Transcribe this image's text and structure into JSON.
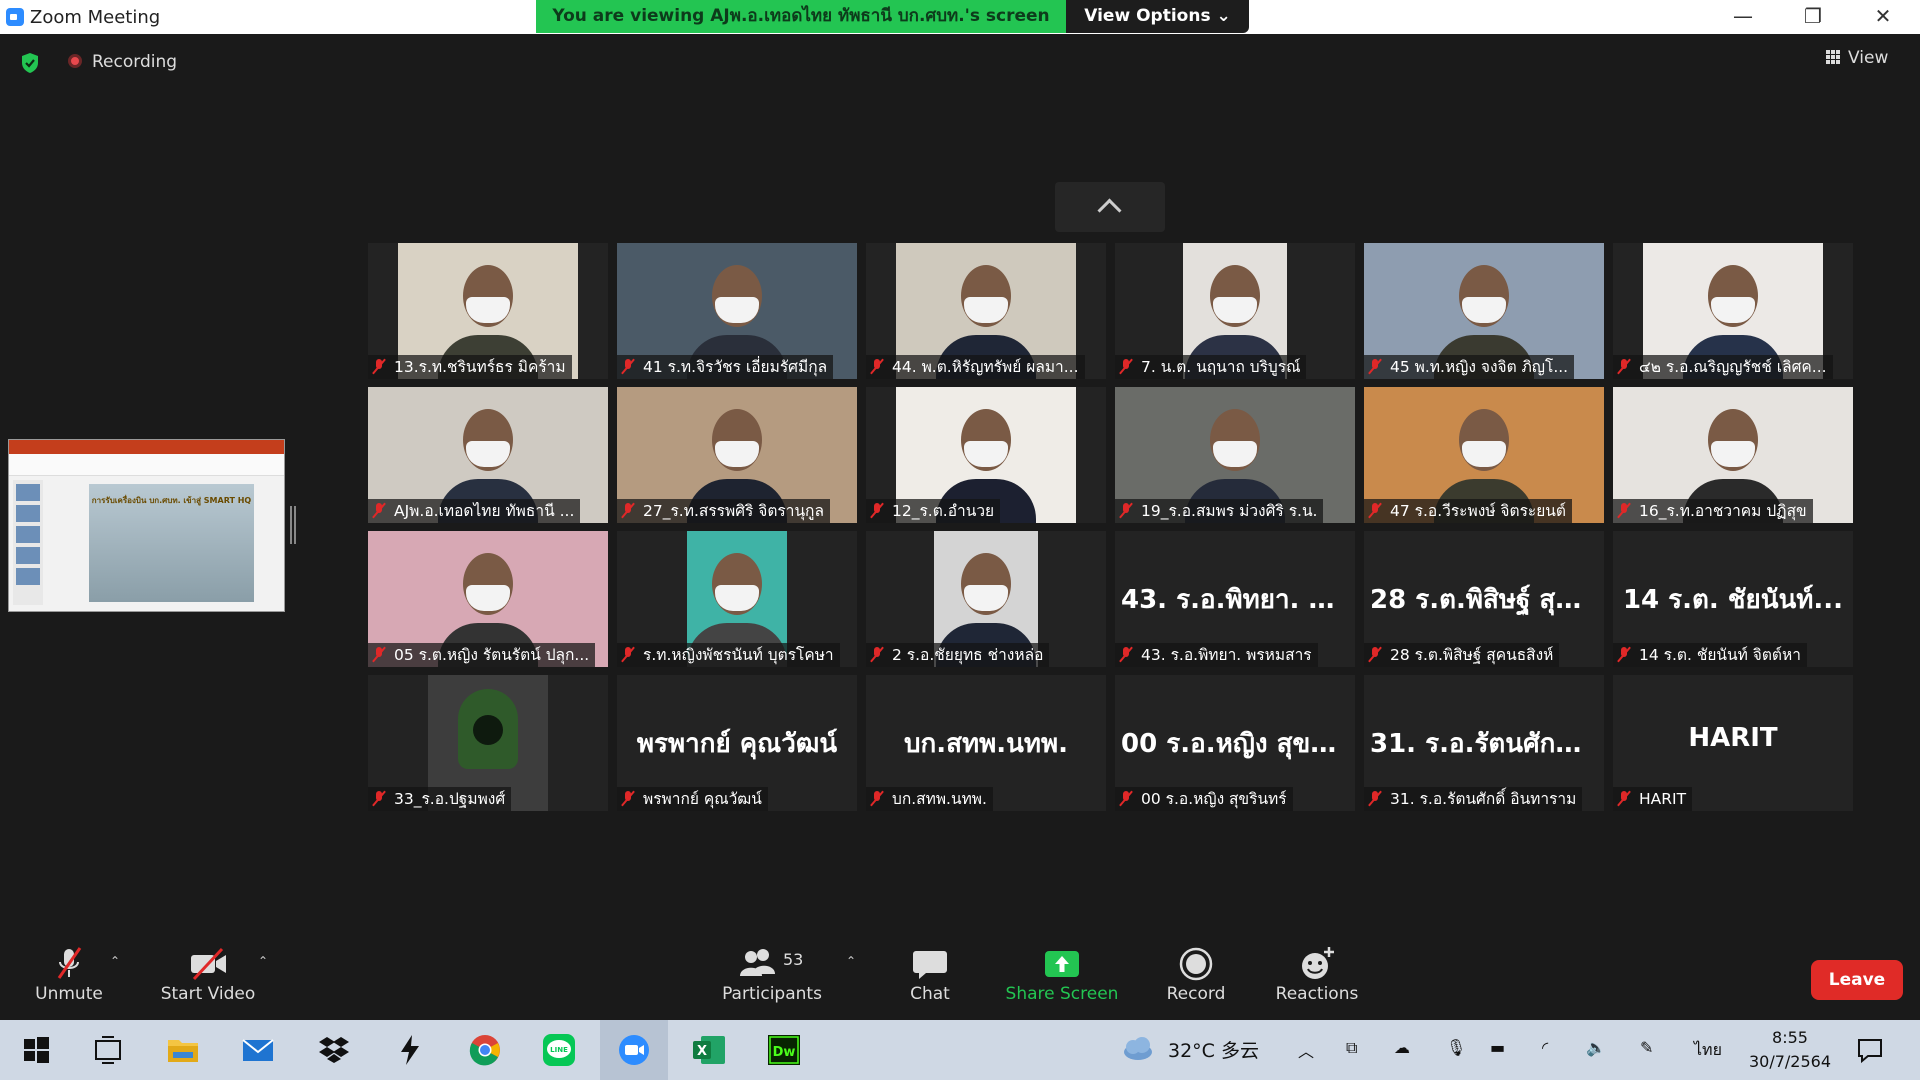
{
  "window": {
    "title": "Zoom Meeting",
    "share_banner": "You are viewing AJพ.อ.เทอดไทย ทัพธานี  บก.ศบท.'s screen",
    "view_options": "View Options ⌄",
    "minimize": "—",
    "restore": "❐",
    "close": "✕"
  },
  "meeting": {
    "recording_label": "Recording",
    "view_label": "View",
    "accent_color": "#23c552"
  },
  "participants": [
    {
      "name": "13.ร.ท.ชรินทร์ธร มิคร้าม",
      "video": true,
      "shirt": "#3d3f34"
    },
    {
      "name": "41 ร.ท.จิรวัชร เอี่ยมรัศมีกุล",
      "video": true,
      "shirt": "#2a2f3a"
    },
    {
      "name": "44. พ.ต.หิรัญทรัพย์ ผลมา...",
      "video": true,
      "shirt": "#1f2636"
    },
    {
      "name": "7. น.ต. นฤนาถ   บริบูรณ์",
      "video": true,
      "shirt": "#2c3245"
    },
    {
      "name": "45 พ.ท.หญิง จงจิต  ภิญโ...",
      "video": true,
      "shirt": "#3a3a30"
    },
    {
      "name": "๔๒ ร.อ.ณริญญรัชช์ เลิศค...",
      "video": true,
      "shirt": "#26324a"
    },
    {
      "name": "AJพ.อ.เทอดไทย ทัพธานี  ...",
      "video": true,
      "shirt": "#283040"
    },
    {
      "name": "27_ร.ท.สรรพศิริ  จิตรานุกูล",
      "video": true,
      "shirt": "#1e2330"
    },
    {
      "name": "12_ร.ต.อำนวย",
      "video": true,
      "shirt": "#1c2030"
    },
    {
      "name": "19_ร.อ.สมพร  ม่วงศิริ ร.น.",
      "video": true,
      "shirt": "#252b3a"
    },
    {
      "name": "47 ร.อ.วีระพงษ์ จิตระยนต์",
      "video": true,
      "shirt": "#3b3b2e"
    },
    {
      "name": "16_ร.ท.อาชวาคม ปฏิสุข",
      "video": true,
      "shirt": "#2a2a2a"
    },
    {
      "name": "05 ร.ต.หญิง รัตนรัตน์ ปลุก...",
      "video": true,
      "shirt": "#333"
    },
    {
      "name": "ร.ท.หญิงพัชรนันท์ บุตรโคษา",
      "video": true,
      "shirt": "#444"
    },
    {
      "name": "2  ร.อ.ชัยยุทธ  ช่างหล่อ",
      "video": true,
      "shirt": "#1f2636"
    },
    {
      "name": "43. ร.อ.พิทยา.  พรหมสาร",
      "video": false,
      "big": "43. ร.อ.พิทยา.  พ..."
    },
    {
      "name": "28 ร.ต.พิสิษฐ์ สุคนธสิงห์",
      "video": false,
      "big": "28 ร.ต.พิสิษฐ์ สุค..."
    },
    {
      "name": "14 ร.ต. ชัยนันท์ จิตต์หา",
      "video": false,
      "big": "14 ร.ต. ชัยนันท์..."
    },
    {
      "name": "33_ร.อ.ปฐมพงศ์",
      "video": true,
      "hood": true
    },
    {
      "name": "พรพากย์ คุณวัฒน์",
      "video": false,
      "big": "พรพากย์ คุณวัฒน์"
    },
    {
      "name": "บก.สทพ.นทพ.",
      "video": false,
      "big": "บก.สทพ.นทพ."
    },
    {
      "name": "00 ร.อ.หญิง สุขรินทร์",
      "video": false,
      "big": "00 ร.อ.หญิง สุขริ..."
    },
    {
      "name": "31. ร.อ.รัตนศักดิ์  อินทาราม",
      "video": false,
      "big": "31. ร.อ.รัตนศักดิ..."
    },
    {
      "name": "HARIT",
      "video": false,
      "big": "HARIT"
    }
  ],
  "shared_screen": {
    "slide_title": "การรับเครื่องบิน บก.ศบท. เข้าสู่ SMART HQ"
  },
  "toolbar": {
    "unmute": "Unmute",
    "start_video": "Start Video",
    "participants": "Participants",
    "participant_count": "53",
    "chat": "Chat",
    "share_screen": "Share Screen",
    "record": "Record",
    "reactions": "Reactions",
    "leave": "Leave",
    "caret": "⌃"
  },
  "taskbar": {
    "weather": "32°C  多云",
    "language": "ไทย",
    "time": "8:55",
    "date": "30/7/2564",
    "apps": [
      "start",
      "task-view",
      "file-explorer",
      "mail",
      "dropbox",
      "app-s",
      "chrome",
      "line",
      "zoom",
      "excel",
      "dreamweaver"
    ]
  }
}
